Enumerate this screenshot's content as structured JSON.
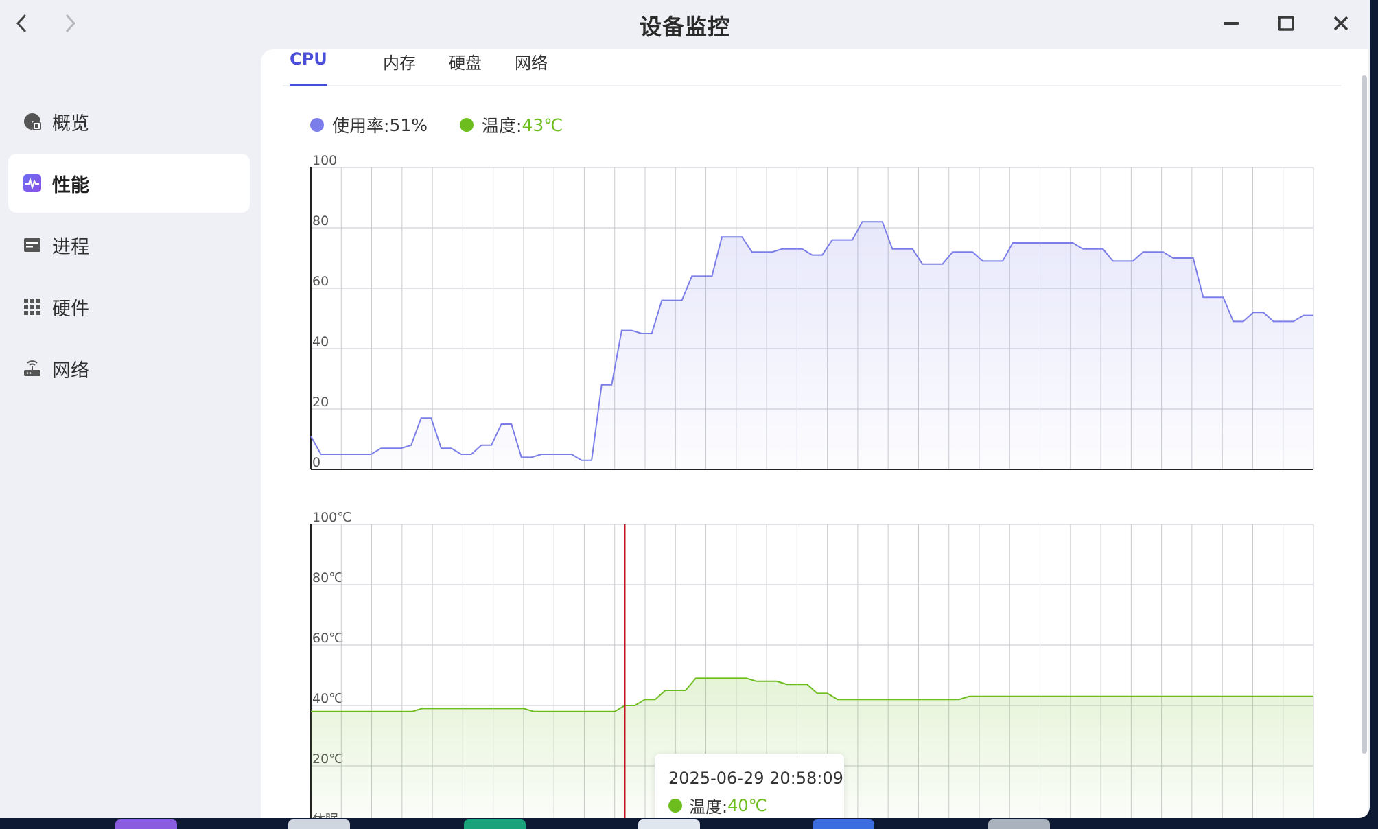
{
  "window": {
    "title": "设备监控"
  },
  "sidebar": {
    "items": [
      {
        "label": "概览",
        "icon": "overview-icon",
        "active": false
      },
      {
        "label": "性能",
        "icon": "performance-icon",
        "active": true
      },
      {
        "label": "进程",
        "icon": "process-icon",
        "active": false
      },
      {
        "label": "硬件",
        "icon": "hardware-icon",
        "active": false
      },
      {
        "label": "网络",
        "icon": "network-icon",
        "active": false
      }
    ]
  },
  "tabs": [
    {
      "label": "CPU",
      "active": true
    },
    {
      "label": "内存",
      "active": false
    },
    {
      "label": "硬盘",
      "active": false
    },
    {
      "label": "网络",
      "active": false
    }
  ],
  "legend": {
    "usage": {
      "label": "使用率: ",
      "value": "51%",
      "color": "#7b7ee8"
    },
    "temperature": {
      "label": "温度: ",
      "value": "43℃",
      "color": "#6ebd1f"
    }
  },
  "tooltip": {
    "time": "2025-06-29 20:58:09",
    "label": "温度: ",
    "value": "40℃"
  },
  "colors": {
    "accent": "#4a4ed8",
    "usage_line": "#7b7ee8",
    "temp_line": "#6ebd1f",
    "cursor": "#c1121f"
  },
  "chart_data": [
    {
      "type": "area",
      "series": [
        {
          "name": "使用率",
          "values": [
            11,
            5,
            5,
            5,
            5,
            5,
            5,
            7,
            7,
            7,
            8,
            17,
            17,
            7,
            7,
            5,
            5,
            8,
            8,
            15,
            15,
            4,
            4,
            5,
            5,
            5,
            5,
            3,
            3,
            28,
            28,
            46,
            46,
            45,
            45,
            56,
            56,
            56,
            64,
            64,
            64,
            77,
            77,
            77,
            72,
            72,
            72,
            73,
            73,
            73,
            71,
            71,
            76,
            76,
            76,
            82,
            82,
            82,
            73,
            73,
            73,
            68,
            68,
            68,
            72,
            72,
            72,
            69,
            69,
            69,
            75,
            75,
            75,
            75,
            75,
            75,
            75,
            73,
            73,
            73,
            69,
            69,
            69,
            72,
            72,
            72,
            70,
            70,
            70,
            57,
            57,
            57,
            49,
            49,
            52,
            52,
            49,
            49,
            49,
            51,
            51
          ]
        }
      ],
      "ylim": [
        0,
        100
      ],
      "yticks": [
        "100",
        "80",
        "60",
        "40",
        "20",
        "0"
      ],
      "grid": true,
      "grid_columns": 33
    },
    {
      "type": "area",
      "series": [
        {
          "name": "温度",
          "values": [
            38,
            38,
            38,
            38,
            38,
            38,
            38,
            38,
            38,
            38,
            38,
            39,
            39,
            39,
            39,
            39,
            39,
            39,
            39,
            39,
            39,
            39,
            38,
            38,
            38,
            38,
            38,
            38,
            38,
            38,
            38,
            40,
            40,
            42,
            42,
            45,
            45,
            45,
            49,
            49,
            49,
            49,
            49,
            49,
            48,
            48,
            48,
            47,
            47,
            47,
            44,
            44,
            42,
            42,
            42,
            42,
            42,
            42,
            42,
            42,
            42,
            42,
            42,
            42,
            42,
            43,
            43,
            43,
            43,
            43,
            43,
            43,
            43,
            43,
            43,
            43,
            43,
            43,
            43,
            43,
            43,
            43,
            43,
            43,
            43,
            43,
            43,
            43,
            43,
            43,
            43,
            43,
            43,
            43,
            43,
            43,
            43,
            43,
            43,
            43
          ]
        }
      ],
      "ylim": [
        0,
        100
      ],
      "yticks": [
        "100℃",
        "80℃",
        "60℃",
        "40℃",
        "20℃",
        "休眠"
      ],
      "grid": true,
      "grid_columns": 33,
      "cursor_index": 31
    }
  ]
}
